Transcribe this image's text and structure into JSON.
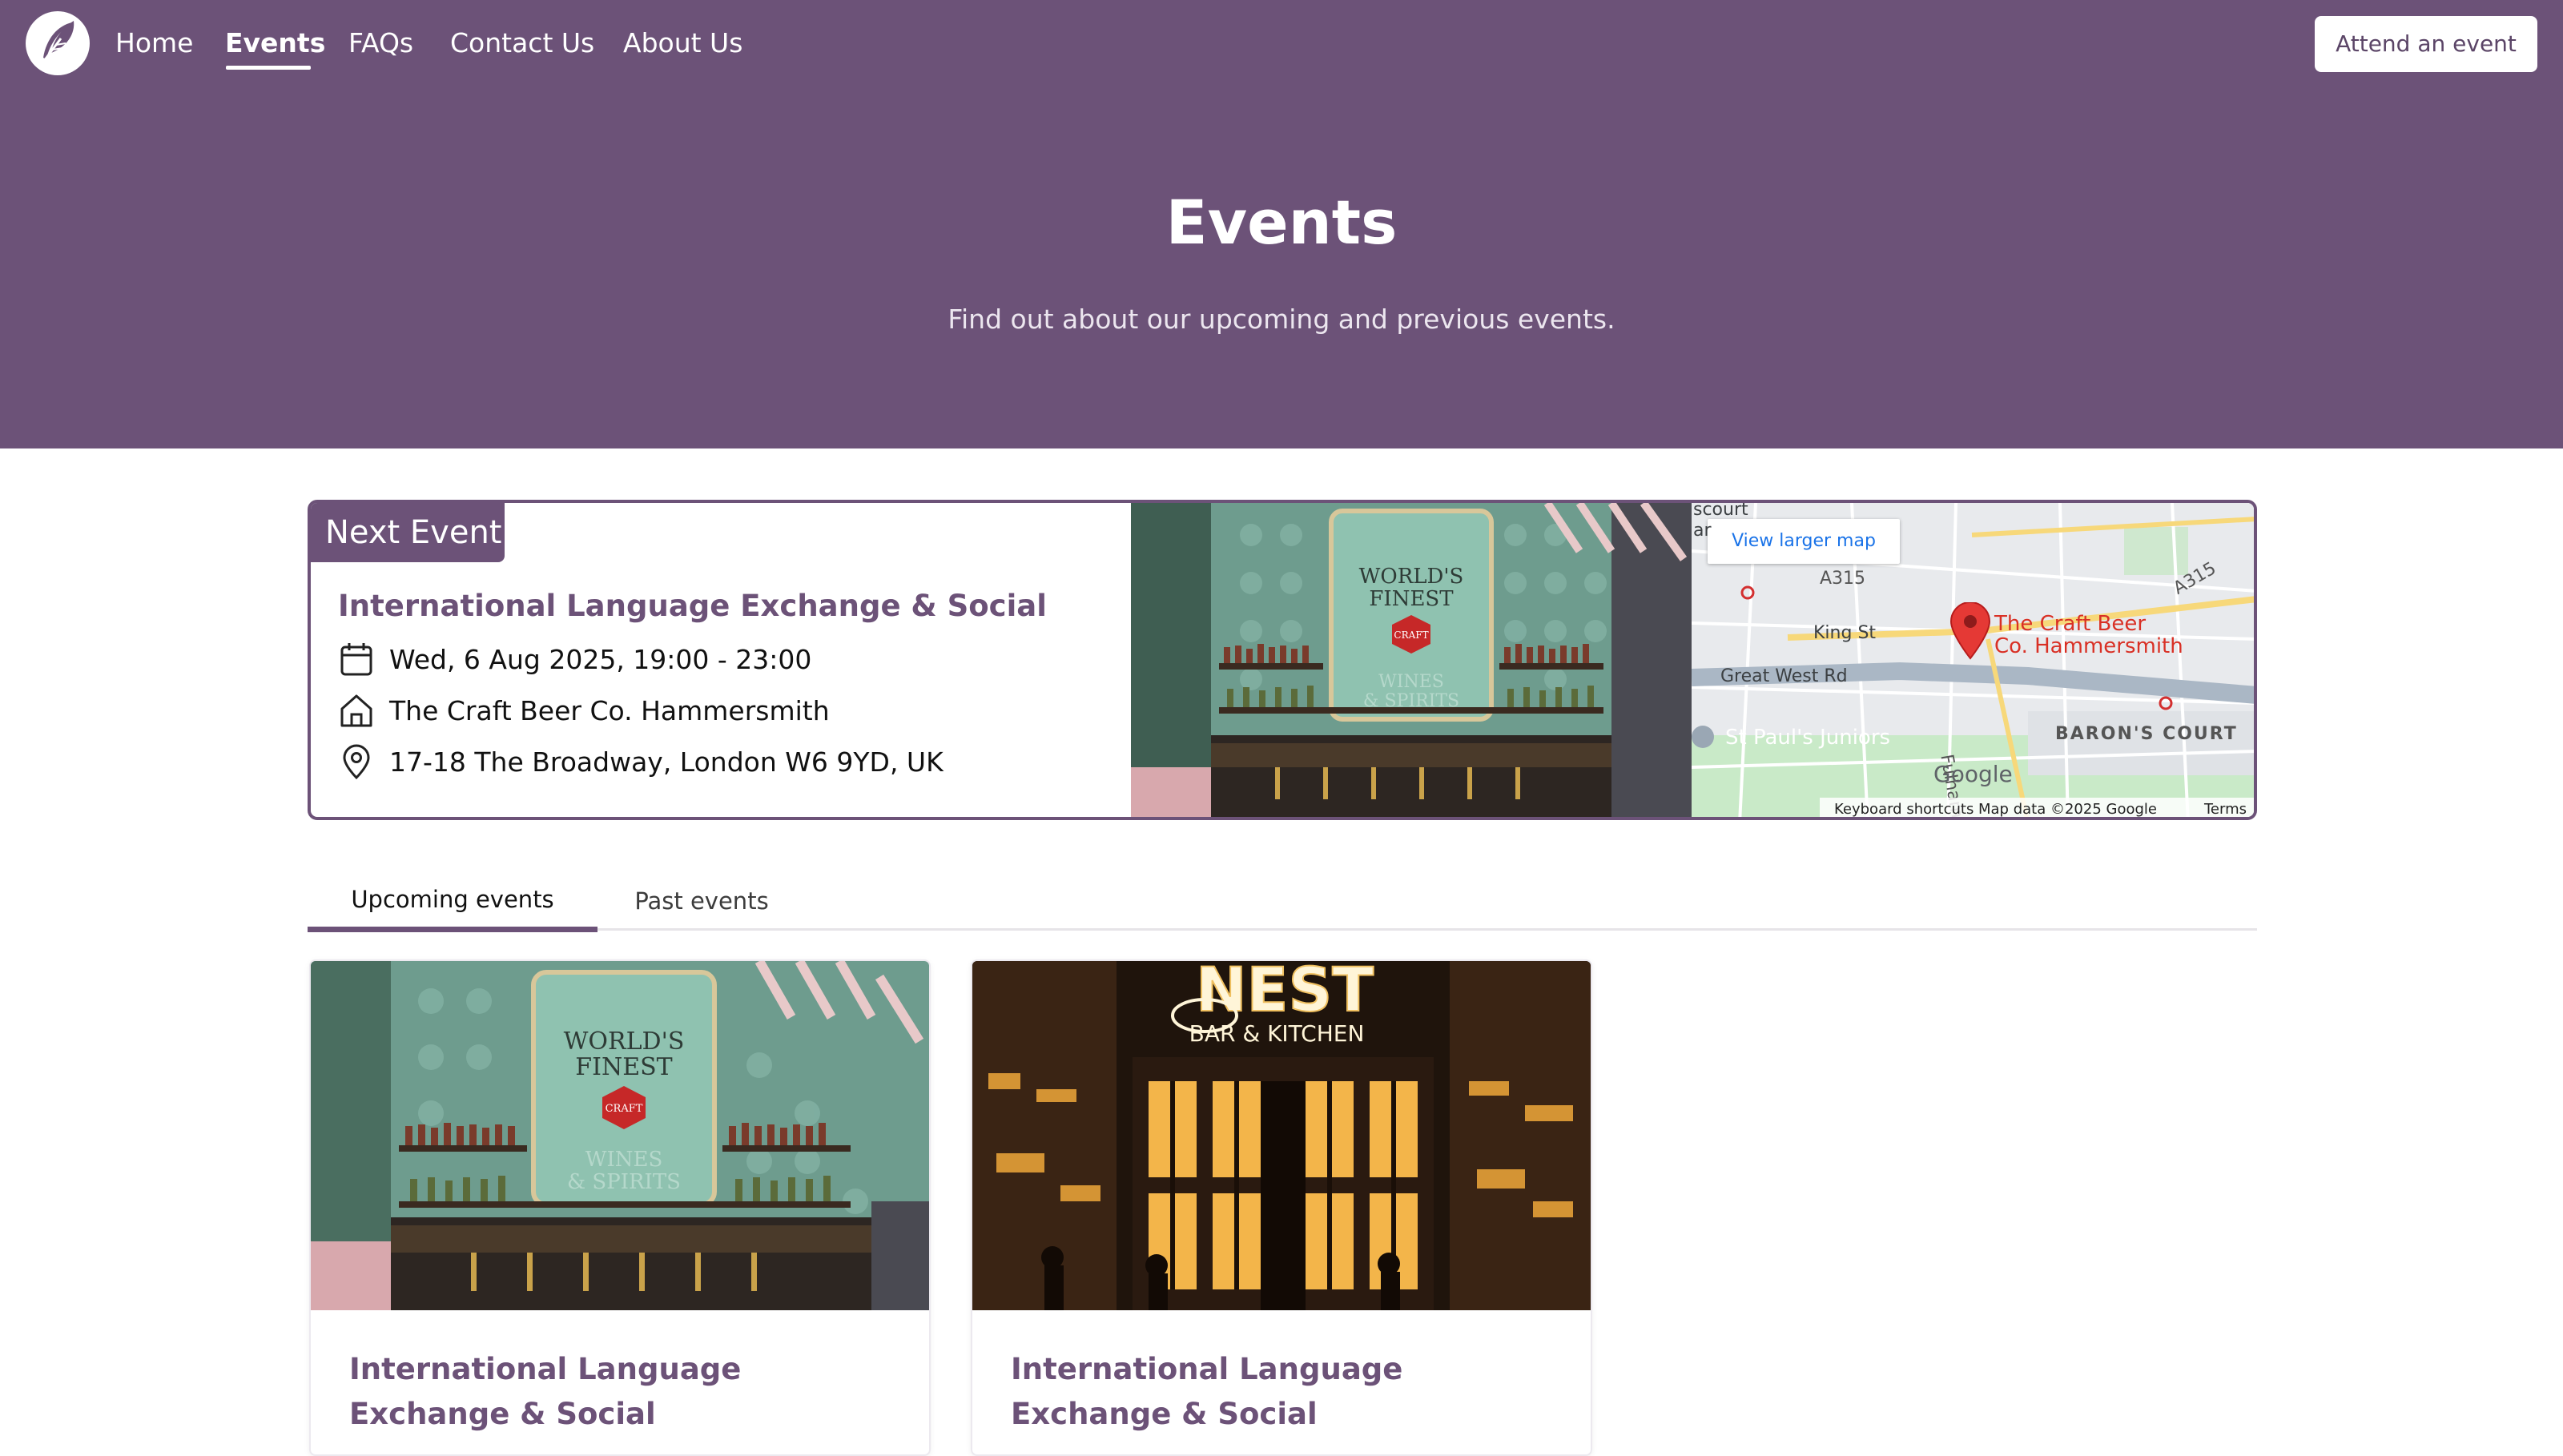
{
  "nav": {
    "links": [
      "Home",
      "Events",
      "FAQs",
      "Contact Us",
      "About Us"
    ],
    "active": "Events",
    "cta_label": "Attend an event"
  },
  "hero": {
    "title": "Events",
    "subtitle": "Find out about our upcoming and previous events."
  },
  "next_event": {
    "badge": "Next Event",
    "title": "International Language Exchange & Social",
    "datetime": "Wed, 6 Aug 2025, 19:00 - 23:00",
    "venue": "The Craft Beer Co. Hammersmith",
    "address": "17-18 The Broadway, London W6 9YD, UK",
    "photo_sign": [
      "WORLD'S",
      "FINEST",
      "CRAFT",
      "WINES",
      "& SPIRITS"
    ],
    "map": {
      "larger_map_label": "View larger map",
      "pin_label_line1": "The Craft Beer",
      "pin_label_line2": "Co. Hammersmith",
      "streets": [
        "A315",
        "A315",
        "King St",
        "Great West Rd",
        "Fulham Palace",
        "BARON'S COURT",
        "St Paul's Juniors",
        "scourt",
        "ar"
      ],
      "logo": "Google",
      "footer": [
        "Keyboard shortcuts",
        "Map data ©2025 Google",
        "Terms"
      ]
    }
  },
  "tabs": {
    "items": [
      "Upcoming events",
      "Past events"
    ],
    "active": "Upcoming events"
  },
  "events": [
    {
      "title": "International Language Exchange & Social",
      "image": "craft-beer-bar",
      "sign": [
        "WORLD'S",
        "FINEST",
        "CRAFT",
        "WINES",
        "& SPIRITS"
      ]
    },
    {
      "title": "International Language Exchange & Social",
      "image": "nest-bar-kitchen",
      "sign": [
        "NEST",
        "BAR & KITCHEN"
      ]
    }
  ],
  "colors": {
    "brand": "#6c5278",
    "map_pin": "#e53935",
    "map_link": "#1a73e8"
  },
  "icons": [
    "feather-logo-icon",
    "calendar-icon",
    "home-icon",
    "location-pin-icon",
    "map-pin-icon"
  ]
}
